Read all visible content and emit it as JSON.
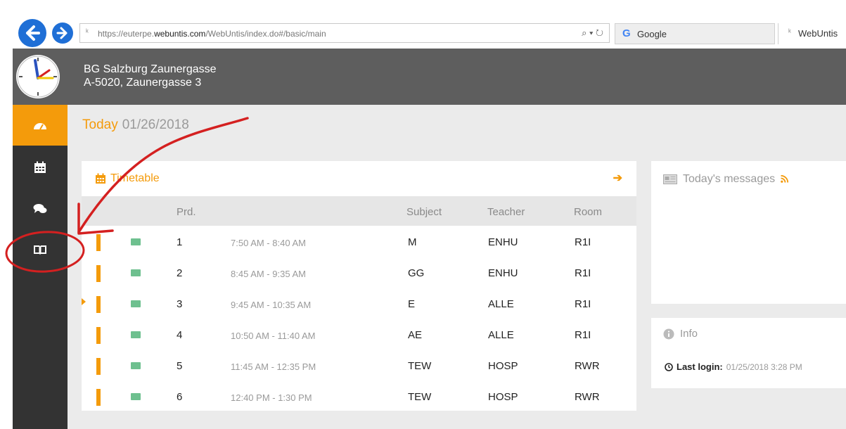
{
  "browser": {
    "url_prefix": "https://euterpe.",
    "url_domain": "webuntis.com",
    "url_path": "/WebUntis/index.do#/basic/main",
    "url_controls": "⌕ ▾ ↻",
    "tabs": [
      {
        "label": "Google",
        "icon_glyph": "G"
      },
      {
        "label": "WebUntis",
        "icon_glyph": "ᵏ"
      }
    ]
  },
  "header": {
    "school_name": "BG Salzburg Zaunergasse",
    "school_address": "A-5020, Zaunergasse 3"
  },
  "sidebar": {
    "items": [
      {
        "name": "dashboard",
        "icon": "dashboard-icon",
        "active": true
      },
      {
        "name": "calendar",
        "icon": "calendar-icon",
        "active": false
      },
      {
        "name": "messages",
        "icon": "chat-icon",
        "active": false
      },
      {
        "name": "classbook",
        "icon": "book-icon",
        "active": false
      }
    ]
  },
  "today": {
    "label": "Today",
    "date": "01/26/2018"
  },
  "timetable": {
    "title": "Timetable",
    "arrow": "➔",
    "columns": {
      "period": "Prd.",
      "subject": "Subject",
      "teacher": "Teacher",
      "room": "Room"
    },
    "current_period": 3,
    "rows": [
      {
        "prd": "1",
        "time": "7:50 AM - 8:40 AM",
        "subject": "M",
        "teacher": "ENHU",
        "room": "R1I"
      },
      {
        "prd": "2",
        "time": "8:45 AM - 9:35 AM",
        "subject": "GG",
        "teacher": "ENHU",
        "room": "R1I"
      },
      {
        "prd": "3",
        "time": "9:45 AM - 10:35 AM",
        "subject": "E",
        "teacher": "ALLE",
        "room": "R1I"
      },
      {
        "prd": "4",
        "time": "10:50 AM - 11:40 AM",
        "subject": "AE",
        "teacher": "ALLE",
        "room": "R1I"
      },
      {
        "prd": "5",
        "time": "11:45 AM - 12:35 PM",
        "subject": "TEW",
        "teacher": "HOSP",
        "room": "RWR"
      },
      {
        "prd": "6",
        "time": "12:40 PM - 1:30 PM",
        "subject": "TEW",
        "teacher": "HOSP",
        "room": "RWR"
      }
    ]
  },
  "messages": {
    "title": "Today's messages"
  },
  "info": {
    "title": "Info",
    "last_login_label": "Last login:",
    "last_login_value": "01/25/2018 3:28 PM"
  },
  "colors": {
    "accent": "#f49b0b",
    "header_bg": "#5e5e5e",
    "sidebar_bg": "#333333",
    "content_bg": "#ebebeb",
    "annotation": "#d42020"
  }
}
